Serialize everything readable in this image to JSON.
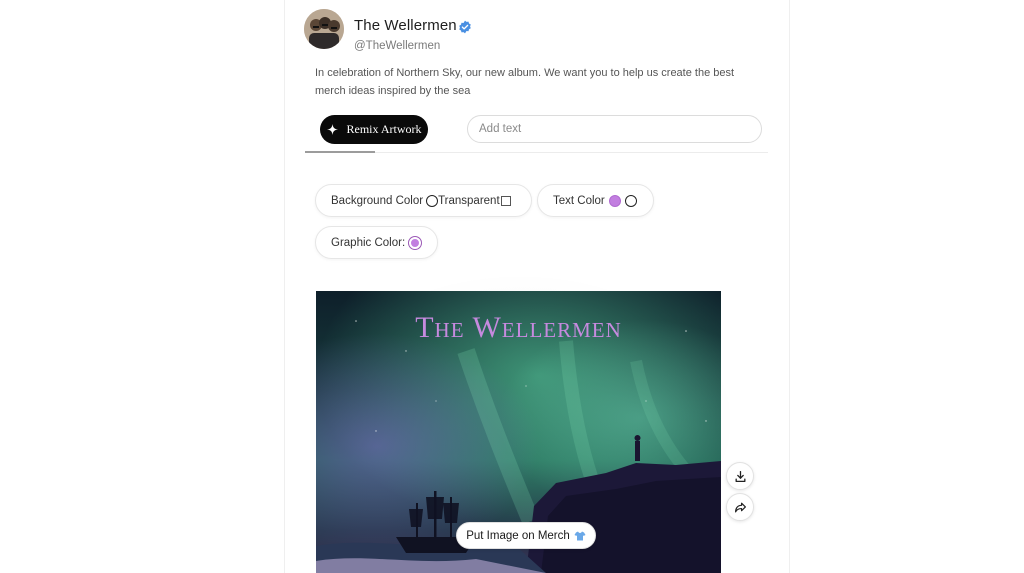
{
  "post": {
    "author_name": "The Wellermen",
    "author_handle": "@TheWellermen",
    "verified": true,
    "text": "In celebration of Northern Sky, our new album. We want you to help us create the best merch ideas inspired by the sea"
  },
  "actions": {
    "remix_label": "Remix Artwork",
    "add_text_placeholder": "Add text"
  },
  "style_options": {
    "background_color_label": "Background Color",
    "transparent_label": "Transparent",
    "text_color_label": "Text Color",
    "graphic_color_label": "Graphic Color:"
  },
  "artwork": {
    "title": "The Wellermen",
    "merch_button_label": "Put Image on Merch"
  },
  "icons": {
    "remix": "sparkle-icon",
    "verified": "verified-badge-icon",
    "merch": "tshirt-icon",
    "download": "download-icon",
    "share": "share-icon"
  },
  "colors": {
    "accent_purple": "#c27ee0",
    "verified_blue": "#4a90e2",
    "button_black": "#0a0a0a"
  }
}
